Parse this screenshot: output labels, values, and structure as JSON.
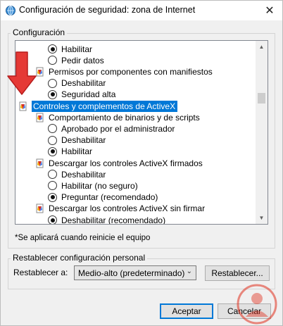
{
  "window": {
    "title": "Configuración de seguridad: zona de Internet",
    "close_glyph": "✕"
  },
  "config_group": {
    "legend": "Configuración"
  },
  "tree": {
    "rows": [
      {
        "kind": "radio",
        "label": "Habilitar",
        "checked": true
      },
      {
        "kind": "radio",
        "label": "Pedir datos",
        "checked": false
      },
      {
        "kind": "node",
        "label": "Permisos por componentes con manifiestos",
        "icon": "settings-node-icon"
      },
      {
        "kind": "radio",
        "label": "Deshabilitar",
        "checked": false
      },
      {
        "kind": "radio",
        "label": "Seguridad alta",
        "checked": true
      },
      {
        "kind": "category",
        "label": "Controles y complementos de ActiveX",
        "icon": "activex-category-icon",
        "selected": true
      },
      {
        "kind": "node",
        "label": "Comportamiento de binarios y de scripts",
        "icon": "activex-node-icon"
      },
      {
        "kind": "radio",
        "label": "Aprobado por el administrador",
        "checked": false
      },
      {
        "kind": "radio",
        "label": "Deshabilitar",
        "checked": false
      },
      {
        "kind": "radio",
        "label": "Habilitar",
        "checked": true
      },
      {
        "kind": "node",
        "label": "Descargar los controles ActiveX firmados",
        "icon": "activex-node-icon"
      },
      {
        "kind": "radio",
        "label": "Deshabilitar",
        "checked": false
      },
      {
        "kind": "radio",
        "label": "Habilitar (no seguro)",
        "checked": false
      },
      {
        "kind": "radio",
        "label": "Preguntar (recomendado)",
        "checked": true
      },
      {
        "kind": "node",
        "label": "Descargar los controles ActiveX sin firmar",
        "icon": "activex-node-icon"
      },
      {
        "kind": "radio",
        "label": "Deshabilitar (recomendado)",
        "checked": true
      }
    ],
    "scroll_up": "▲",
    "scroll_down": "▼"
  },
  "note": "*Se aplicará cuando reinicie el equipo",
  "reset_group": {
    "legend": "Restablecer configuración personal",
    "label": "Restablecer a:",
    "selected_option": "Medio-alto (predeterminado)",
    "reset_button": "Restablecer..."
  },
  "footer": {
    "ok_button": "Aceptar",
    "cancel_button": "Cancelar"
  },
  "colors": {
    "selection": "#0078d7",
    "annotation_arrow": "#e53935",
    "watermark": "#e0301e"
  }
}
